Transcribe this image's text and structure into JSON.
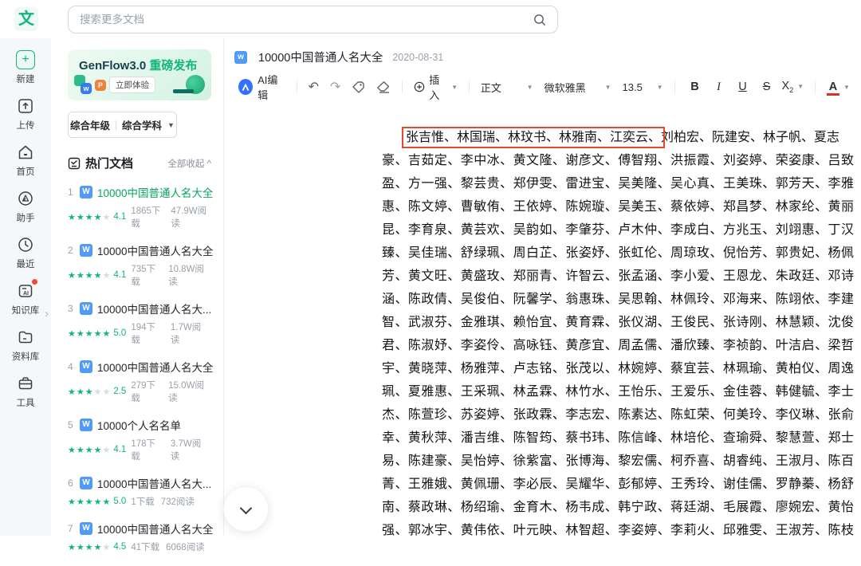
{
  "app": {
    "logo_glyph": "文"
  },
  "topbar": {
    "search_placeholder": "搜索更多文档"
  },
  "rail": {
    "items": [
      {
        "label": "新建"
      },
      {
        "label": "上传"
      },
      {
        "label": "首页"
      },
      {
        "label": "助手"
      },
      {
        "label": "最近"
      },
      {
        "label": "知识库"
      },
      {
        "label": "资料库"
      },
      {
        "label": "工具"
      }
    ]
  },
  "sidebar": {
    "banner": {
      "title": "GenFlow3.0",
      "subtitle": "重磅发布",
      "cta": "立即体验",
      "word_badge": "w",
      "ppt_badge": "P"
    },
    "filters": {
      "grade": "综合年级",
      "subject": "综合学科"
    },
    "hot_docs": {
      "title": "热门文档",
      "collapse_all": "全部收起 ^",
      "items": [
        {
          "rank": "1",
          "title": "10000中国普通人名大全",
          "stars_full": "★★★★",
          "stars_empty": "★",
          "rating": "4.1",
          "downloads": "1865下载",
          "reads": "47.9W阅读"
        },
        {
          "rank": "2",
          "title": "10000中国普通人名大全",
          "stars_full": "★★★★",
          "stars_empty": "★",
          "rating": "4.1",
          "downloads": "735下载",
          "reads": "10.8W阅读"
        },
        {
          "rank": "3",
          "title": "10000中国普通人名大...",
          "stars_full": "★★★★★",
          "stars_empty": "",
          "rating": "5.0",
          "downloads": "194下载",
          "reads": "1.7W阅读"
        },
        {
          "rank": "4",
          "title": "10000中国普通人名大全",
          "stars_full": "★★★",
          "stars_empty": "★★",
          "rating": "2.5",
          "downloads": "279下载",
          "reads": "15.0W阅读"
        },
        {
          "rank": "5",
          "title": "10000个人名名单",
          "stars_full": "★★★★",
          "stars_empty": "★",
          "rating": "4.1",
          "downloads": "178下载",
          "reads": "3.7W阅读"
        },
        {
          "rank": "6",
          "title": "10000中国普通人名大...",
          "stars_full": "★★★★★",
          "stars_empty": "",
          "rating": "5.0",
          "downloads": "1下载",
          "reads": "732阅读"
        },
        {
          "rank": "7",
          "title": "10000中国普通人名大全",
          "stars_full": "★★★★",
          "stars_empty": "★",
          "rating": "4.5",
          "downloads": "41下载",
          "reads": "6068阅读"
        }
      ]
    }
  },
  "document": {
    "title": "10000中国普通人名大全",
    "date": "2020-08-31",
    "doc_icon": "w",
    "toolbar": {
      "ai_edit": "AI编辑",
      "insert": "插入",
      "paragraph_style": "正文",
      "font_name": "微软雅黑",
      "font_size": "13.5",
      "bold": "B",
      "italic": "I",
      "underline": "U",
      "strikethrough": "S",
      "subscript_base": "X",
      "subscript_sub": "2",
      "font_color": "A"
    },
    "body": {
      "highlighted": "张吉惟、林国瑞、林玟书、林雅南、江奕云、",
      "first_line_rest": "刘柏宏、阮建安、林子帆、夏志",
      "lines": [
        "豪、吉茹定、李中冰、黄文隆、谢彦文、傅智翔、洪振霞、刘姿婷、荣姿康、吕致",
        "盈、方一强、黎芸贵、郑伊雯、雷进宝、吴美隆、吴心真、王美珠、郭芳天、李雅",
        "惠、陈文婷、曹敏侑、王依婷、陈婉璇、吴美玉、蔡依婷、郑昌梦、林家纶、黄丽",
        "昆、李育泉、黄芸欢、吴韵如、李肇芬、卢木仲、李成白、方兆玉、刘翊惠、丁汉",
        "臻、吴佳瑞、舒绿珮、周白芷、张姿妤、张虹伦、周琼玫、倪怡芳、郭贵妃、杨佩",
        "芳、黄文旺、黄盛玫、郑丽青、许智云、张孟涵、李小爱、王恩龙、朱政廷、邓诗",
        "涵、陈政倩、吴俊伯、阮馨学、翁惠珠、吴思翰、林佩玲、邓海来、陈翊依、李建",
        "智、武淑芬、金雅琪、赖怡宜、黄育霖、张仪湖、王俊民、张诗刚、林慧颖、沈俊",
        "君、陈淑妤、李姿伶、高咏钰、黄彦宜、周孟儒、潘欣臻、李祯韵、叶洁启、梁哲",
        "宇、黄晓萍、杨雅萍、卢志铭、张茂以、林婉婷、蔡宜芸、林珮瑜、黄柏仪、周逸",
        "珮、夏雅惠、王采珮、林孟霖、林竹水、王怡乐、王爱乐、金佳蓉、韩健毓、李士",
        "杰、陈萱珍、苏姿婷、张政霖、李志宏、陈素达、陈虹荣、何美玲、李仪琳、张俞",
        "幸、黄秋萍、潘吉维、陈智筠、蔡书玮、陈信峰、林培伦、查瑜舜、黎慧萱、郑士",
        "易、陈建豪、吴怡婷、徐紫富、张博海、黎宏儒、柯乔喜、胡睿纯、王淑月、陈百",
        "菁、王雅娥、黄佩珊、李必辰、吴耀华、彭郁婷、王秀玲、谢佳儒、罗静蓁、杨舒",
        "南、蔡政琳、杨绍瑜、金育木、杨韦成、韩宁政、蒋廷湖、毛展霞、廖婉宏、黄怡",
        "强、郭冰宇、黄伟依、叶元映、林智超、李姿婷、李莉火、邱雅雯、王淑芳、陈枝"
      ]
    }
  },
  "colors": {
    "accent_green": "#12b37c",
    "star_green": "#14b37f",
    "active_title_green": "#07a562",
    "red_box": "#e24a2e",
    "ai_blue": "#3370ff",
    "word_icon_blue": "#4f9bf5",
    "font_color_bar_red": "#d93026",
    "badge_red": "#f5483b"
  }
}
